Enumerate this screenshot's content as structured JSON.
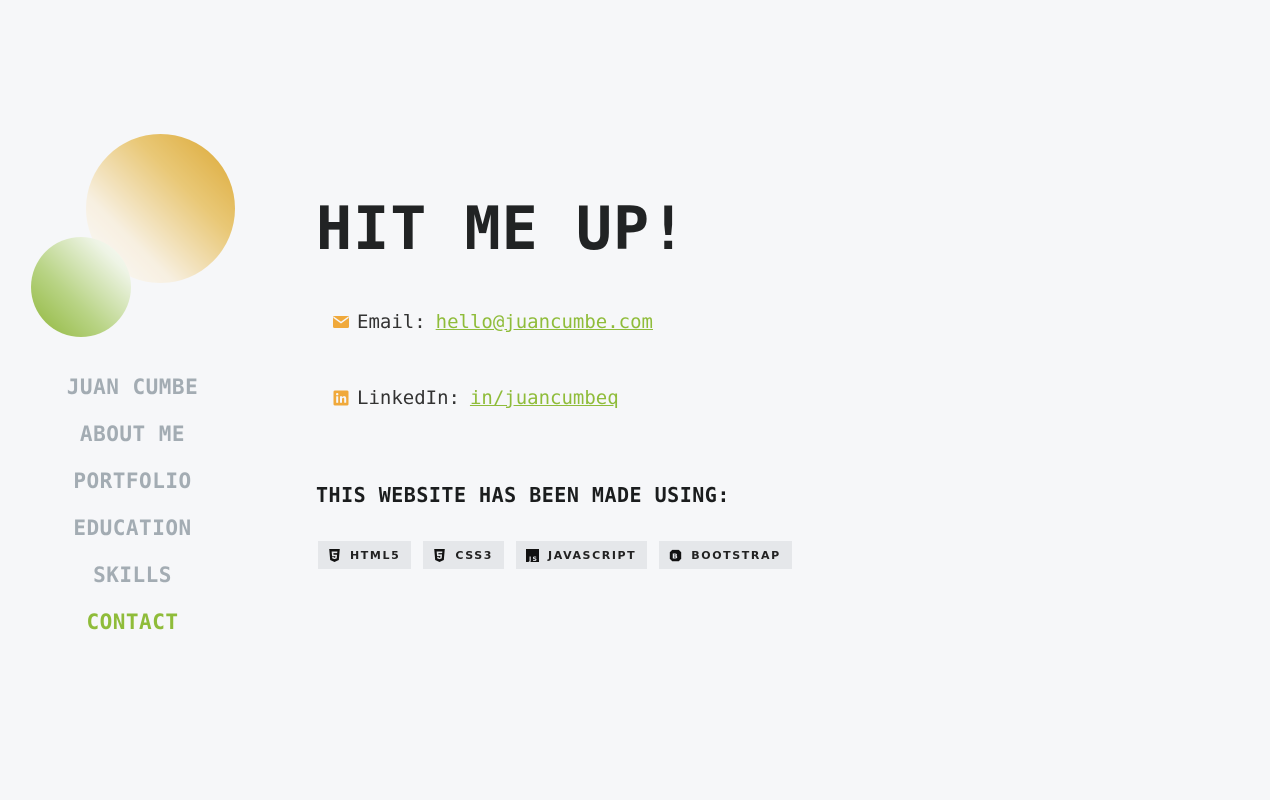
{
  "nav": {
    "items": [
      {
        "label": "JUAN CUMBE"
      },
      {
        "label": "ABOUT ME"
      },
      {
        "label": "PORTFOLIO"
      },
      {
        "label": "EDUCATION"
      },
      {
        "label": "SKILLS"
      },
      {
        "label": "CONTACT"
      }
    ],
    "active": "CONTACT"
  },
  "main": {
    "title": "HIT ME UP!",
    "email": {
      "label": "Email:",
      "value": "hello@juancumbe.com",
      "icon": "envelope-icon"
    },
    "linkedin": {
      "label": "LinkedIn:",
      "value": "in/juancumbeq",
      "icon": "linkedin-icon"
    },
    "made_with_heading": "THIS WEBSITE HAS BEEN MADE USING:",
    "badges": [
      {
        "label": "HTML5",
        "icon": "html5-icon"
      },
      {
        "label": "CSS3",
        "icon": "css3-icon"
      },
      {
        "label": "JAVASCRIPT",
        "icon": "javascript-icon"
      },
      {
        "label": "BOOTSTRAP",
        "icon": "bootstrap-icon"
      }
    ]
  },
  "colors": {
    "accent": "#8fbc3a",
    "icon_orange": "#f0a93b",
    "nav_text": "#a3acb3",
    "background": "#f6f7f9"
  }
}
